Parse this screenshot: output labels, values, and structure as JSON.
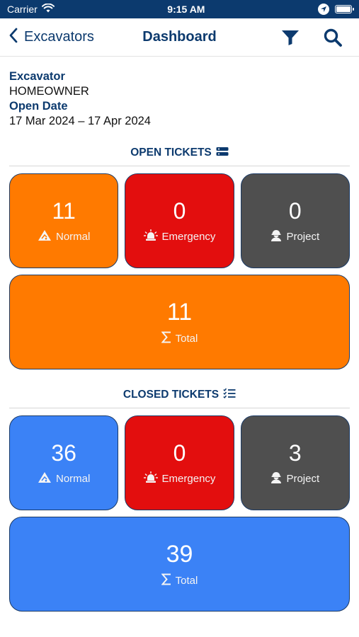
{
  "status_bar": {
    "carrier": "Carrier",
    "time": "9:15 AM"
  },
  "nav": {
    "back_label": "Excavators",
    "title": "Dashboard"
  },
  "info": {
    "excavator_label": "Excavator",
    "excavator_value": "HOMEOWNER",
    "open_date_label": "Open Date",
    "open_date_value": "17 Mar 2024 – 17 Apr 2024"
  },
  "open_tickets": {
    "title": "OPEN TICKETS",
    "normal": {
      "value": "11",
      "label": "Normal"
    },
    "emergency": {
      "value": "0",
      "label": "Emergency"
    },
    "project": {
      "value": "0",
      "label": "Project"
    },
    "total": {
      "value": "11",
      "label": "Total"
    }
  },
  "closed_tickets": {
    "title": "CLOSED TICKETS",
    "normal": {
      "value": "36",
      "label": "Normal"
    },
    "emergency": {
      "value": "0",
      "label": "Emergency"
    },
    "project": {
      "value": "3",
      "label": "Project"
    },
    "total": {
      "value": "39",
      "label": "Total"
    }
  },
  "colors": {
    "navy": "#0c3a6e",
    "open_accent": "#ff7a00",
    "closed_accent": "#3b82f6",
    "emergency": "#e30e0e",
    "project": "#4f4f4f"
  }
}
